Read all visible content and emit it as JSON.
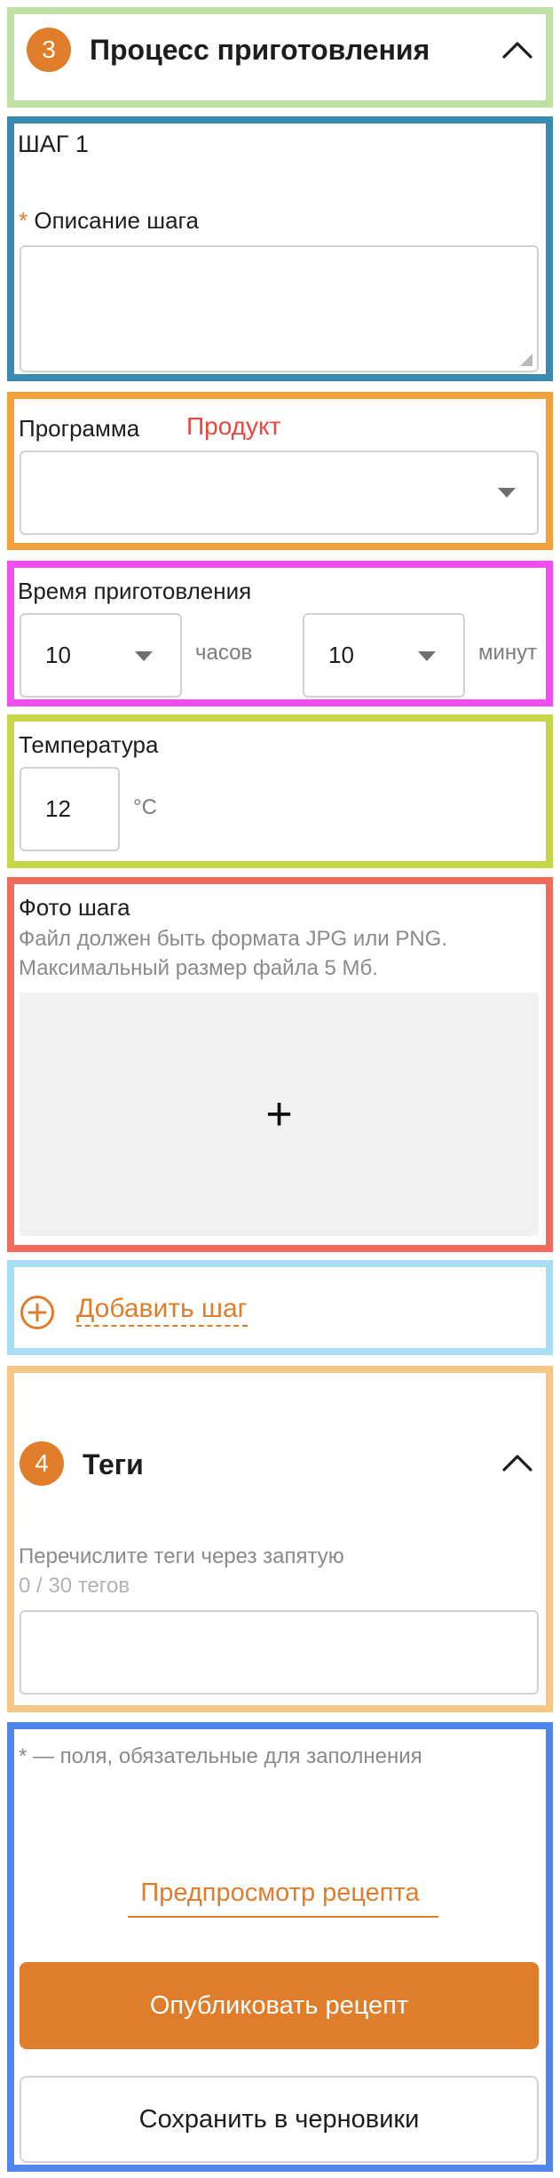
{
  "section3": {
    "number": "3",
    "title": "Процесс приготовления"
  },
  "step": {
    "heading": "ШАГ 1",
    "required_mark": "*",
    "description_label": "Описание шага",
    "description_value": ""
  },
  "program": {
    "label": "Программа",
    "product_link": "Продукт",
    "value": ""
  },
  "cook_time": {
    "label": "Время приготовления",
    "hours_value": "10",
    "hours_unit": "часов",
    "minutes_value": "10",
    "minutes_unit": "минут"
  },
  "temperature": {
    "label": "Температура",
    "value": "12",
    "unit": "°С"
  },
  "photo": {
    "label": "Фото шага",
    "hint_line1": "Файл должен быть формата JPG или PNG.",
    "hint_line2": "Максимальный размер файла 5 Мб.",
    "plus": "+"
  },
  "add_step": {
    "label": "Добавить шаг"
  },
  "section4": {
    "number": "4",
    "title": "Теги",
    "hint": "Перечислите теги через запятую",
    "counter": "0 / 30 тегов",
    "value": ""
  },
  "footer": {
    "required_note": "* — поля, обязательные для заполнения",
    "preview_link": "Предпросмотр рецепта",
    "publish_button": "Опубликовать рецепт",
    "draft_button": "Сохранить в черновики"
  },
  "colors": {
    "accent": "#e07d2a",
    "danger": "#e8473c",
    "border": "#d2d2d5"
  }
}
